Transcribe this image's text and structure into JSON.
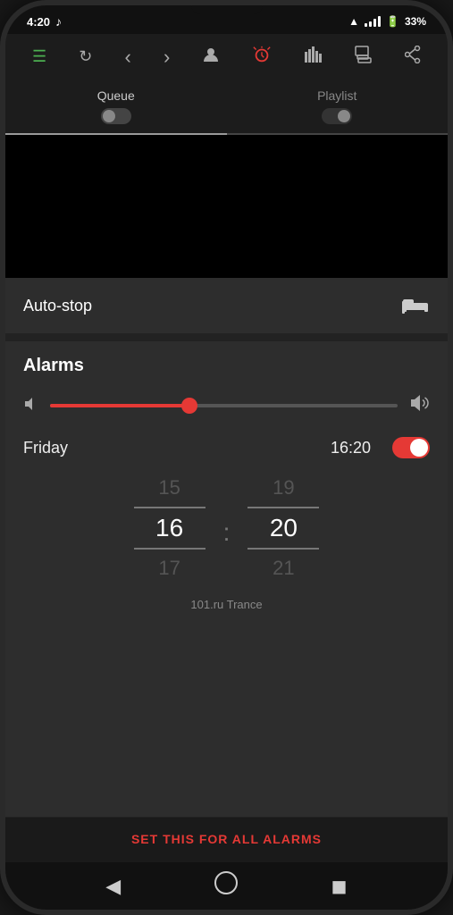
{
  "status": {
    "time": "4:20",
    "music_note": "♪",
    "battery": "33%",
    "battery_icon": "🔋"
  },
  "nav": {
    "icons": [
      {
        "name": "menu-icon",
        "symbol": "☰",
        "active": true
      },
      {
        "name": "refresh-icon",
        "symbol": "↻",
        "active": false
      },
      {
        "name": "back-icon",
        "symbol": "‹",
        "active": false
      },
      {
        "name": "forward-icon",
        "symbol": "›",
        "active": false
      },
      {
        "name": "profile-icon",
        "symbol": "👤",
        "active": false
      },
      {
        "name": "alarm-icon",
        "symbol": "⏰",
        "active": true,
        "alarm": true
      },
      {
        "name": "equalizer-icon",
        "symbol": "📊",
        "active": false
      },
      {
        "name": "devices-icon",
        "symbol": "📋",
        "active": false
      },
      {
        "name": "share-icon",
        "symbol": "⤴",
        "active": false
      }
    ]
  },
  "tabs": [
    {
      "label": "Queue",
      "active": true
    },
    {
      "label": "Playlist",
      "active": false
    }
  ],
  "auto_stop": {
    "label": "Auto-stop",
    "icon": "🛏"
  },
  "alarms": {
    "title": "Alarms",
    "volume_slider_percent": 40,
    "alarm_day": "Friday",
    "alarm_time": "16:20",
    "alarm_enabled": true,
    "time_picker": {
      "hours": {
        "prev": "15",
        "current": "16",
        "next": "17"
      },
      "minutes": {
        "prev": "19",
        "current": "20",
        "next": "21"
      }
    },
    "station": "101.ru Trance",
    "set_all_label": "SET THIS FOR ALL ALARMS"
  },
  "bottom_nav": {
    "back": "◀",
    "home": "⬤",
    "recent": "◼"
  }
}
